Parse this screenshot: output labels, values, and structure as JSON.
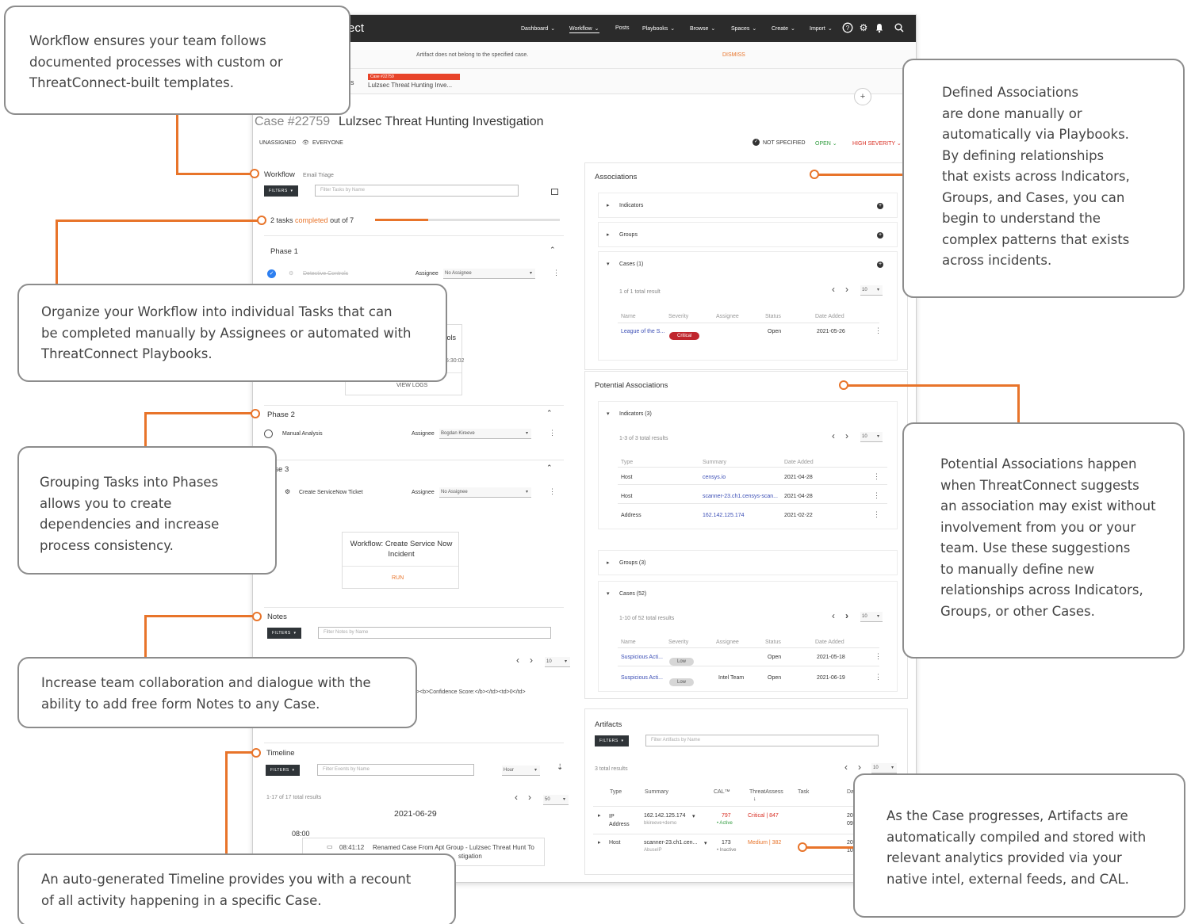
{
  "app": {
    "brand": "ect",
    "nav": [
      {
        "label": "Dashboard",
        "chevron": true
      },
      {
        "label": "Workflow",
        "chevron": true,
        "active": true
      },
      {
        "label": "Posts",
        "chevron": false
      },
      {
        "label": "Playbooks",
        "chevron": true
      },
      {
        "label": "Browse",
        "chevron": true
      },
      {
        "label": "Spaces",
        "chevron": true
      },
      {
        "label": "Create",
        "chevron": true
      },
      {
        "label": "Import",
        "chevron": true
      }
    ],
    "nav_icons": [
      "help-icon",
      "gear-icon",
      "bell-icon",
      "search-icon"
    ],
    "alert": {
      "message": "Artifact does not belong to the specified case.",
      "action": "DISMISS"
    },
    "case_tab": {
      "prefix": "es",
      "badge": "Case #22759",
      "title": "Lulzsec Threat Hunting Inve..."
    }
  },
  "case": {
    "number": "Case #22759",
    "title": "Lulzsec Threat Hunting Investigation",
    "assignee": "UNASSIGNED",
    "visibility": "EVERYONE",
    "resolution": "NOT SPECIFIED",
    "status": "OPEN",
    "severity": "HIGH SEVERITY"
  },
  "workflow": {
    "label": "Workflow",
    "template": "Email Triage",
    "filters_label": "FILTERS",
    "filter_placeholder": "Filter Tasks by Name",
    "progress_prefix": "2 tasks",
    "progress_mid": "completed",
    "progress_suffix": "out of 7",
    "progress_fraction": 0.2857,
    "phase1": {
      "label": "Phase 1",
      "task": "Detective Controls",
      "assignee_label": "Assignee",
      "assignee": "No Assignee"
    },
    "popup1": {
      "title_tail": "trols",
      "time_tail": "5:30:02",
      "action": "VIEW LOGS"
    },
    "phase2": {
      "label": "Phase 2",
      "task": "Manual Analysis",
      "assignee_label": "Assignee",
      "assignee": "Bogdan Kireeve"
    },
    "phase3": {
      "label": "ase 3",
      "task": "Create ServiceNow Ticket",
      "assignee_label": "Assignee",
      "assignee": "No Assignee"
    },
    "popup3": {
      "title": "Workflow: Create Service Now Incident",
      "action": "RUN"
    }
  },
  "notes": {
    "label": "Notes",
    "filters_label": "FILTERS",
    "filter_placeholder": "Filter Notes by Name",
    "per_page": "10",
    "snippet": ">&lt;b&gt;Confidence Score:&lt;/b&gt;&lt;/td&gt;&lt;td&gt;0&lt;/td&gt;"
  },
  "timeline": {
    "label": "Timeline",
    "filters_label": "FILTERS",
    "filter_placeholder": "Filter Events by Name",
    "granularity": "Hour",
    "count_text": "1-17 of 17 total results",
    "per_page": "50",
    "date": "2021-06-29",
    "hour": "08:00",
    "event_time": "08:41:12",
    "event_text": "Renamed Case From Apt Group - Lulzsec Threat Hunt To",
    "event_text2": "stigation"
  },
  "associations": {
    "title": "Associations",
    "indicators": "Indicators",
    "groups": "Groups",
    "cases": "Cases (1)",
    "cases_count_text": "1 of 1 total result",
    "per_page": "10",
    "columns": [
      "Name",
      "Severity",
      "Assignee",
      "Status",
      "Date Added"
    ],
    "rows": [
      {
        "name": "League of the S...",
        "severity": "Critical",
        "assignee": "",
        "status": "Open",
        "date": "2021-05-26"
      }
    ]
  },
  "potential": {
    "title": "Potential Associations",
    "indicators": "Indicators (3)",
    "indicators_count_text": "1-3 of 3 total results",
    "per_page": "10",
    "ind_columns": [
      "Type",
      "Summary",
      "Date Added"
    ],
    "ind_rows": [
      {
        "type": "Host",
        "summary": "censys.io",
        "date": "2021-04-28"
      },
      {
        "type": "Host",
        "summary": "scanner-23.ch1.censys-scan...",
        "date": "2021-04-28"
      },
      {
        "type": "Address",
        "summary": "162.142.125.174",
        "date": "2021-02-22"
      }
    ],
    "groups": "Groups (3)",
    "cases": "Cases (52)",
    "cases_count_text": "1-10 of 52 total results",
    "case_columns": [
      "Name",
      "Severity",
      "Assignee",
      "Status",
      "Date Added"
    ],
    "case_rows": [
      {
        "name": "Suspicious Acti...",
        "severity": "Low",
        "assignee": "",
        "status": "Open",
        "date": "2021-05-18"
      },
      {
        "name": "Suspicious Acti...",
        "severity": "Low",
        "assignee": "Intel Team",
        "status": "Open",
        "date": "2021-06-19"
      }
    ]
  },
  "artifacts": {
    "title": "Artifacts",
    "filters_label": "FILTERS",
    "filter_placeholder": "Filter Artifacts by Name",
    "count_text": "3 total results",
    "per_page": "10",
    "columns": [
      "Type",
      "Summary",
      "CAL™",
      "ThreatAssess",
      "Task",
      "Da"
    ],
    "rows": [
      {
        "type": "IP Address",
        "summary": "162.142.125.174",
        "sub": "bkireeve+demo",
        "cal": "797",
        "cal_status": "• Active",
        "threat": "Critical | 847",
        "date": "20",
        "date2": "09"
      },
      {
        "type": "Host",
        "summary": "scanner-23.ch1.cen...",
        "sub": "AbuseIP",
        "cal": "173",
        "cal_status": "• Inactive",
        "threat": "Medium | 382",
        "date": "20",
        "date2": "10"
      }
    ]
  },
  "callouts": {
    "workflow": [
      "Workflow ensures your team follows",
      "documented processes with custom or",
      "ThreatConnect-built templates."
    ],
    "tasks": [
      "Organize your Workflow into individual Tasks that can",
      "be completed manually by Assignees or automated with",
      "ThreatConnect Playbooks."
    ],
    "phases": [
      "Grouping Tasks into Phases",
      "allows you to create",
      "dependencies and increase",
      "process consistency."
    ],
    "notes": [
      "Increase team collaboration and dialogue with the",
      "ability to add free form Notes to any Case."
    ],
    "timeline": [
      "An auto-generated Timeline provides you with a recount",
      "of all activity happening in a specific Case."
    ],
    "associations": [
      "Defined Associations",
      "are done manually or",
      "automatically via Playbooks.",
      "By defining relationships",
      "that exists across Indicators,",
      "Groups, and Cases, you can",
      "begin to understand the",
      "complex patterns that exists",
      "across incidents."
    ],
    "potential": [
      "Potential Associations happen",
      "when ThreatConnect suggests",
      "an association may exist without",
      "involvement from you or your",
      "team. Use these suggestions",
      "to manually define new",
      "relationships across Indicators,",
      "Groups, or other Cases."
    ],
    "artifacts": [
      "As the Case progresses, Artifacts are",
      "automatically compiled and stored with",
      "relevant analytics provided via your",
      "native intel, external feeds, and CAL."
    ]
  },
  "colors": {
    "accent": "#e8742a",
    "critical": "#c0262d",
    "nav_bg": "#2b2b2b",
    "link": "#3a4db5"
  }
}
